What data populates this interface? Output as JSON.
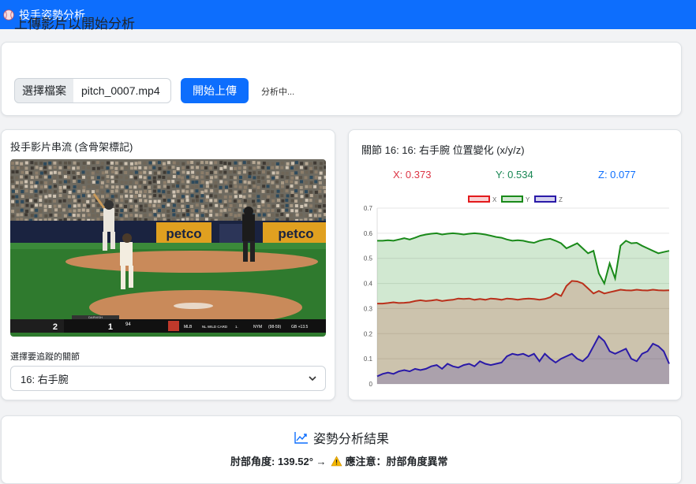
{
  "header": {
    "title": "投手姿勢分析",
    "logo_icon": "baseball-icon"
  },
  "upload": {
    "title": "上傳影片以開始分析",
    "choose_file_label": "選擇檔案",
    "file_name": "pitch_0007.mp4",
    "upload_button": "開始上傳",
    "status": "分析中..."
  },
  "video": {
    "title": "投手影片串流 (含骨架標記)",
    "joint_label": "選擇要追蹤的關節",
    "joint_selected": "16: 右手腕",
    "scorebug": {
      "away_score": "2",
      "pitcher": "DARVISH",
      "pitcher_team": "PIRE",
      "home_score": "1",
      "pitch_speed": "94",
      "league": "MLB",
      "round": "NL WILD CARD",
      "game": "1.",
      "opponent": "NYM",
      "record": "(98-59)",
      "diff": "GB +13.5"
    },
    "sign_text": "petco"
  },
  "chart": {
    "title": "關節 16: 16: 右手腕 位置變化 (x/y/z)",
    "x_readout": "X: 0.373",
    "y_readout": "Y: 0.534",
    "z_readout": "Z: 0.077",
    "colors": {
      "x": "#e31a1c",
      "y": "#1a8a1a",
      "z": "#2a1aa8"
    }
  },
  "chart_data": {
    "type": "area",
    "ylim": [
      0,
      0.7
    ],
    "yticks": [
      "0",
      "0.1",
      "0.2",
      "0.3",
      "0.4",
      "0.5",
      "0.6",
      "0.7"
    ],
    "legend": "top-center",
    "grid": true,
    "series": [
      {
        "name": "X",
        "values": [
          0.32,
          0.32,
          0.322,
          0.325,
          0.322,
          0.323,
          0.325,
          0.33,
          0.333,
          0.33,
          0.332,
          0.335,
          0.33,
          0.333,
          0.335,
          0.34,
          0.338,
          0.34,
          0.335,
          0.338,
          0.335,
          0.34,
          0.338,
          0.335,
          0.34,
          0.338,
          0.335,
          0.338,
          0.34,
          0.338,
          0.335,
          0.338,
          0.345,
          0.36,
          0.35,
          0.39,
          0.41,
          0.408,
          0.4,
          0.38,
          0.36,
          0.37,
          0.36,
          0.365,
          0.37,
          0.375,
          0.373,
          0.372,
          0.375,
          0.373,
          0.372,
          0.375,
          0.373,
          0.372,
          0.373
        ]
      },
      {
        "name": "Y",
        "values": [
          0.57,
          0.57,
          0.572,
          0.57,
          0.575,
          0.58,
          0.575,
          0.582,
          0.59,
          0.595,
          0.598,
          0.6,
          0.595,
          0.598,
          0.6,
          0.598,
          0.595,
          0.598,
          0.6,
          0.598,
          0.595,
          0.59,
          0.585,
          0.582,
          0.575,
          0.57,
          0.572,
          0.57,
          0.565,
          0.562,
          0.57,
          0.575,
          0.578,
          0.57,
          0.56,
          0.54,
          0.55,
          0.56,
          0.54,
          0.52,
          0.53,
          0.44,
          0.4,
          0.48,
          0.42,
          0.55,
          0.57,
          0.56,
          0.562,
          0.55,
          0.54,
          0.53,
          0.52,
          0.525,
          0.53
        ]
      },
      {
        "name": "Z",
        "values": [
          0.03,
          0.04,
          0.045,
          0.04,
          0.05,
          0.055,
          0.05,
          0.06,
          0.055,
          0.06,
          0.07,
          0.075,
          0.06,
          0.08,
          0.07,
          0.065,
          0.075,
          0.08,
          0.07,
          0.09,
          0.08,
          0.075,
          0.08,
          0.085,
          0.11,
          0.12,
          0.115,
          0.12,
          0.11,
          0.12,
          0.09,
          0.12,
          0.1,
          0.085,
          0.1,
          0.11,
          0.12,
          0.1,
          0.09,
          0.11,
          0.15,
          0.19,
          0.17,
          0.13,
          0.12,
          0.13,
          0.14,
          0.1,
          0.09,
          0.12,
          0.13,
          0.16,
          0.15,
          0.13,
          0.08
        ]
      }
    ]
  },
  "result": {
    "title": "姿勢分析結果",
    "title_icon": "trend-chart-icon",
    "text_prefix": "肘部角度: 139.52° →",
    "warning_icon": "warning-icon",
    "text_suffix": "應注意：肘部角度異常"
  }
}
